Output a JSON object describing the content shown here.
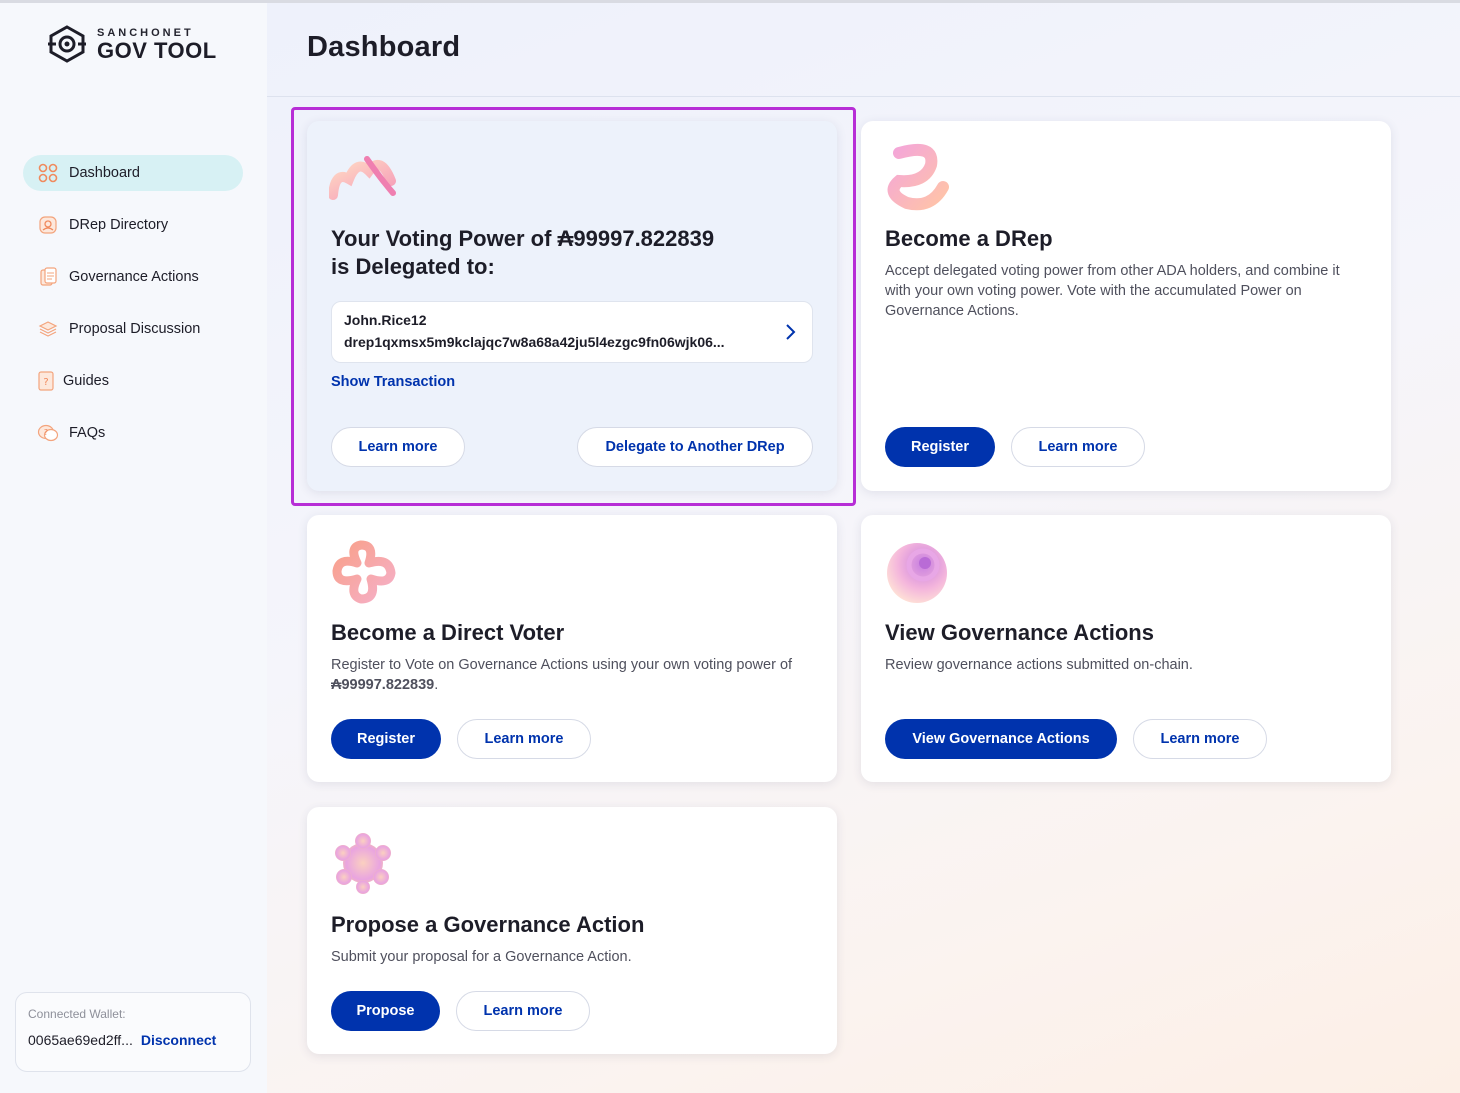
{
  "brand": {
    "top": "SANCHONET",
    "main": "GOV TOOL"
  },
  "nav": {
    "items": [
      {
        "label": "Dashboard",
        "icon": "dashboard-icon",
        "active": true
      },
      {
        "label": "DRep Directory",
        "icon": "drep-directory-icon",
        "active": false
      },
      {
        "label": "Governance Actions",
        "icon": "governance-actions-icon",
        "active": false
      },
      {
        "label": "Proposal Discussion",
        "icon": "proposal-discussion-icon",
        "active": false
      },
      {
        "label": "Guides",
        "icon": "guides-icon",
        "active": false
      },
      {
        "label": "FAQs",
        "icon": "faqs-icon",
        "active": false
      }
    ]
  },
  "wallet": {
    "label": "Connected Wallet:",
    "address": "0065ae69ed2ff...",
    "disconnect": "Disconnect"
  },
  "header": {
    "title": "Dashboard"
  },
  "cards": {
    "delegated": {
      "title_line1": "Your Voting Power of ₳99997.822839",
      "title_line2": "is Delegated to:",
      "drep_name": "John.Rice12",
      "drep_id": "drep1qxmsx5m9kclajqc7w8a68a42ju5l4ezgc9fn06wjk06...",
      "show_transaction": "Show Transaction",
      "learn_more": "Learn more",
      "delegate_another": "Delegate to Another DRep"
    },
    "become_drep": {
      "title": "Become a DRep",
      "description": "Accept delegated voting power from other ADA holders, and combine it with your own voting power. Vote with the accumulated Power on Governance Actions.",
      "register": "Register",
      "learn_more": "Learn more"
    },
    "direct_voter": {
      "title": "Become a Direct Voter",
      "description_prefix": "Register to Vote on Governance Actions using your own voting power of ",
      "amount": "₳99997.822839",
      "description_suffix": ".",
      "register": "Register",
      "learn_more": "Learn more"
    },
    "view_actions": {
      "title": "View Governance Actions",
      "description": "Review governance actions submitted on-chain.",
      "view": "View Governance Actions",
      "learn_more": "Learn more"
    },
    "propose": {
      "title": "Propose a Governance Action",
      "description": "Submit your proposal for a Governance Action.",
      "propose": "Propose",
      "learn_more": "Learn more"
    }
  },
  "colors": {
    "accent": "#0033ad",
    "active_nav": "#d7f1f4",
    "highlight": "#b72ed6"
  }
}
